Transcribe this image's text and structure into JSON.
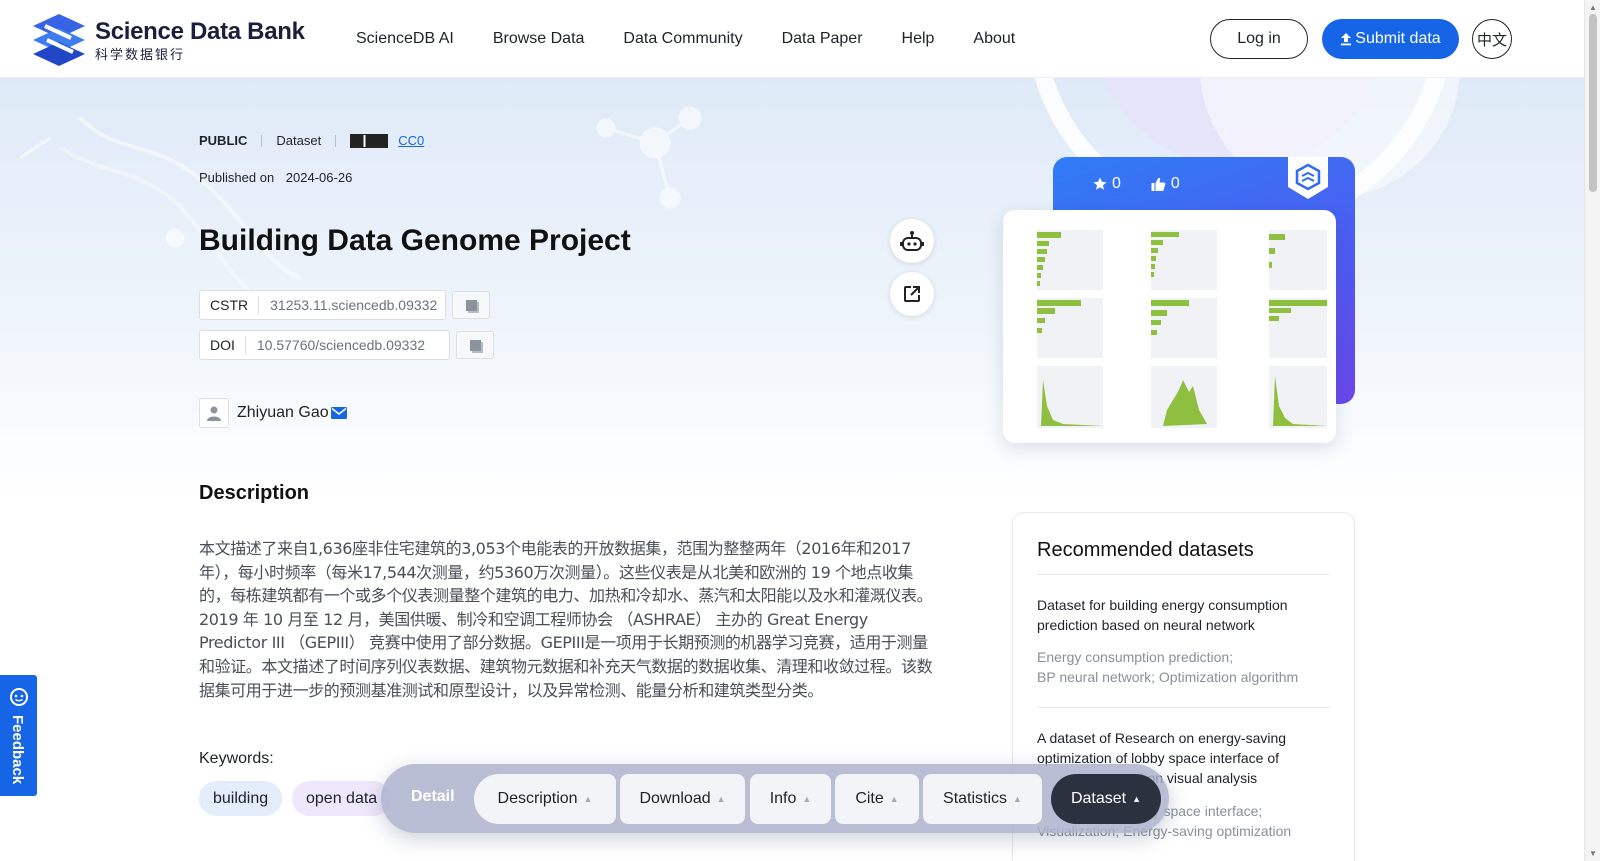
{
  "header": {
    "logo_title": "Science Data Bank",
    "logo_subtitle": "科学数据银行",
    "nav": [
      "ScienceDB AI",
      "Browse Data",
      "Data Community",
      "Data Paper",
      "Help",
      "About"
    ],
    "login_label": "Log in",
    "submit_label": "Submit data",
    "lang_label": "中文",
    "brand_color": "#1665e6"
  },
  "dataset": {
    "visibility": "PUBLIC",
    "type": "Dataset",
    "license": "CC0",
    "published_label": "Published on",
    "published_date": "2024-06-26",
    "title": "Building Data Genome Project",
    "cstr_label": "CSTR",
    "cstr_value": "31253.11.sciencedb.09332",
    "doi_label": "DOI",
    "doi_value": "10.57760/sciencedb.09332",
    "author": "Zhiyuan Gao"
  },
  "description": {
    "heading": "Description",
    "text": "本文描述了来自1,636座非住宅建筑的3,053个电能表的开放数据集，范围为整整两年（2016年和2017年），每小时频率（每米17,544次测量，约5360万次测量）。这些仪表是从北美和欧洲的 19 个地点收集的，每栋建筑都有一个或多个仪表测量整个建筑的电力、加热和冷却水、蒸汽和太阳能以及水和灌溉仪表。2019 年 10 月至 12 月，美国供暖、制冷和空调工程师协会 （ASHRAE） 主办的 Great Energy Predictor III （GEPIII） 竞赛中使用了部分数据。GEPIII是一项用于长期预测的机器学习竞赛，适用于测量和验证。本文描述了时间序列仪表数据、建筑物元数据和补充天气数据的数据收集、清理和收敛过程。该数据集可用于进一步的预测基准测试和原型设计，以及异常检测、能量分析和建筑类型分类。"
  },
  "keywords": {
    "label": "Keywords:",
    "items": [
      "building",
      "open data"
    ]
  },
  "stats": {
    "stars": "0",
    "likes": "0"
  },
  "recommended": {
    "heading": "Recommended datasets",
    "items": [
      {
        "title": "Dataset for building energy consumption prediction based on neural network",
        "keywords_line1": "Energy consumption prediction;",
        "keywords_line2": "BP neural network; Optimization algorithm"
      },
      {
        "title": "A dataset of Research on energy-saving optimization of lobby space interface of",
        "title_line3": "sed on visual analysis",
        "keywords_line1": "bby space interface;",
        "keywords_line2": "Visualization; Energy-saving optimization"
      }
    ]
  },
  "feedback_label": "Feedback",
  "tabbar": {
    "detail": "Detail",
    "tabs": [
      "Description",
      "Download",
      "Info",
      "Cite",
      "Statistics",
      "Dataset"
    ]
  }
}
